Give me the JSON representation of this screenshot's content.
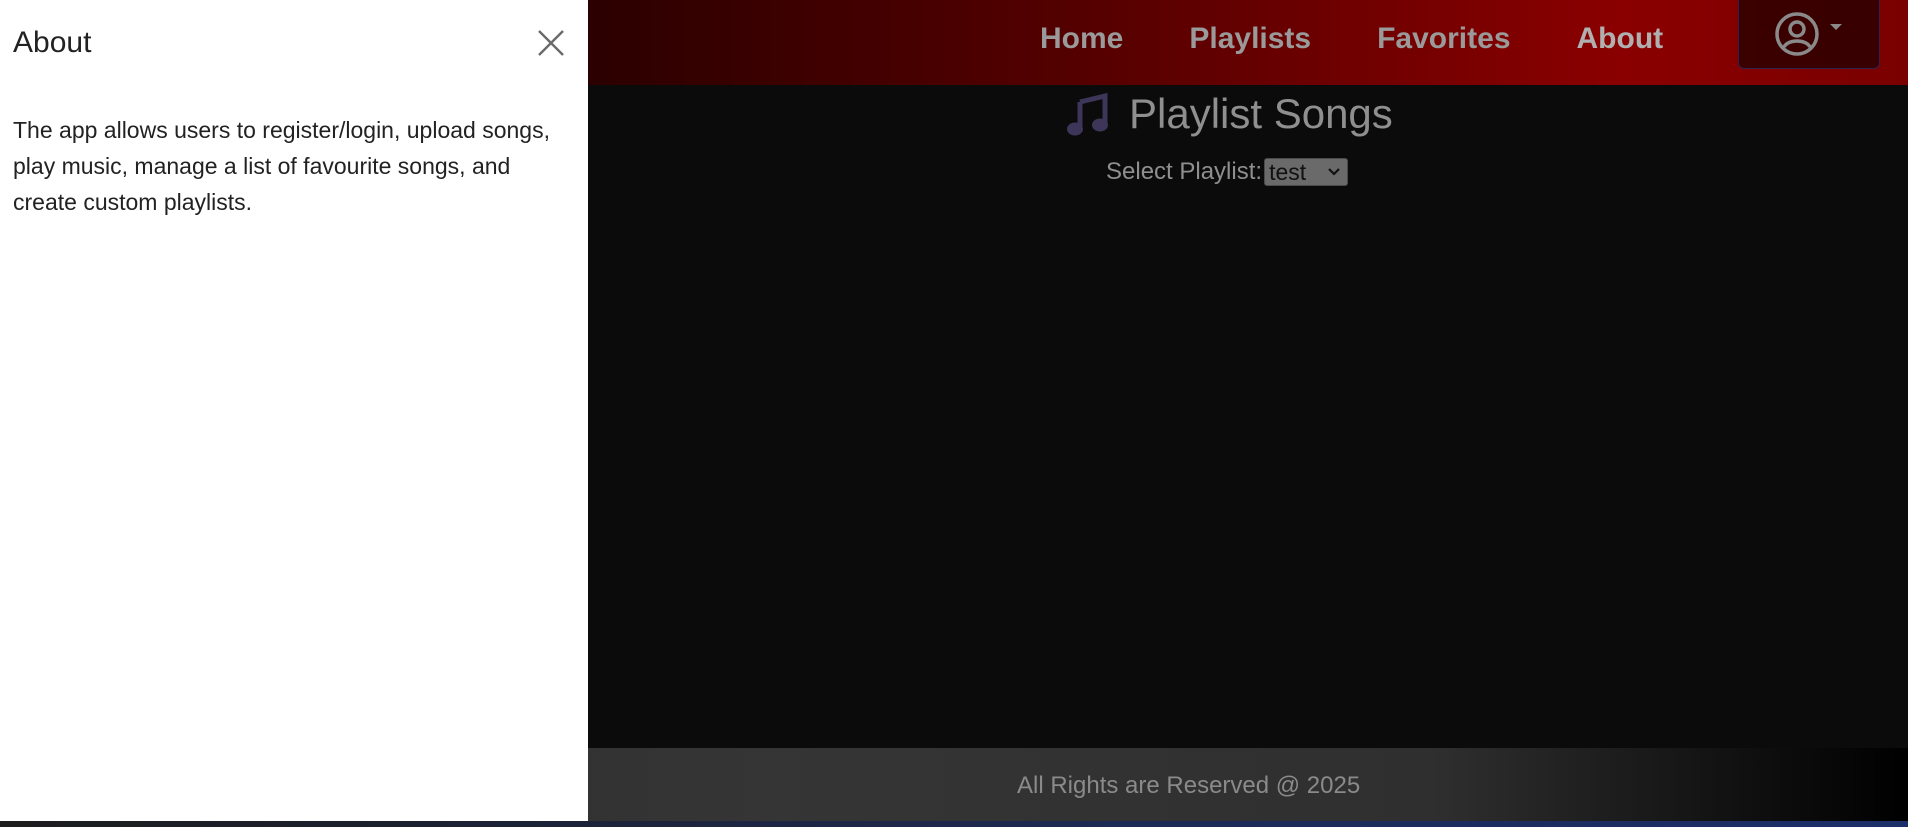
{
  "nav": {
    "links": [
      "Home",
      "Playlists",
      "Favorites",
      "About"
    ],
    "profile_icon": "user-circle-icon"
  },
  "main": {
    "title": "Playlist Songs",
    "title_icon": "music-note-icon",
    "select_label": "Select Playlist:",
    "select_value": "test"
  },
  "footer": {
    "text": "All Rights are Reserved @ 2025"
  },
  "offcanvas": {
    "title": "About",
    "body": "The app allows users to register/login, upload songs, play music, manage a list of favourite songs, and create custom playlists."
  },
  "colors": {
    "navbar_accent": "#8a0000",
    "music_icon": "#3d3658",
    "panel_bg": "#ffffff"
  }
}
